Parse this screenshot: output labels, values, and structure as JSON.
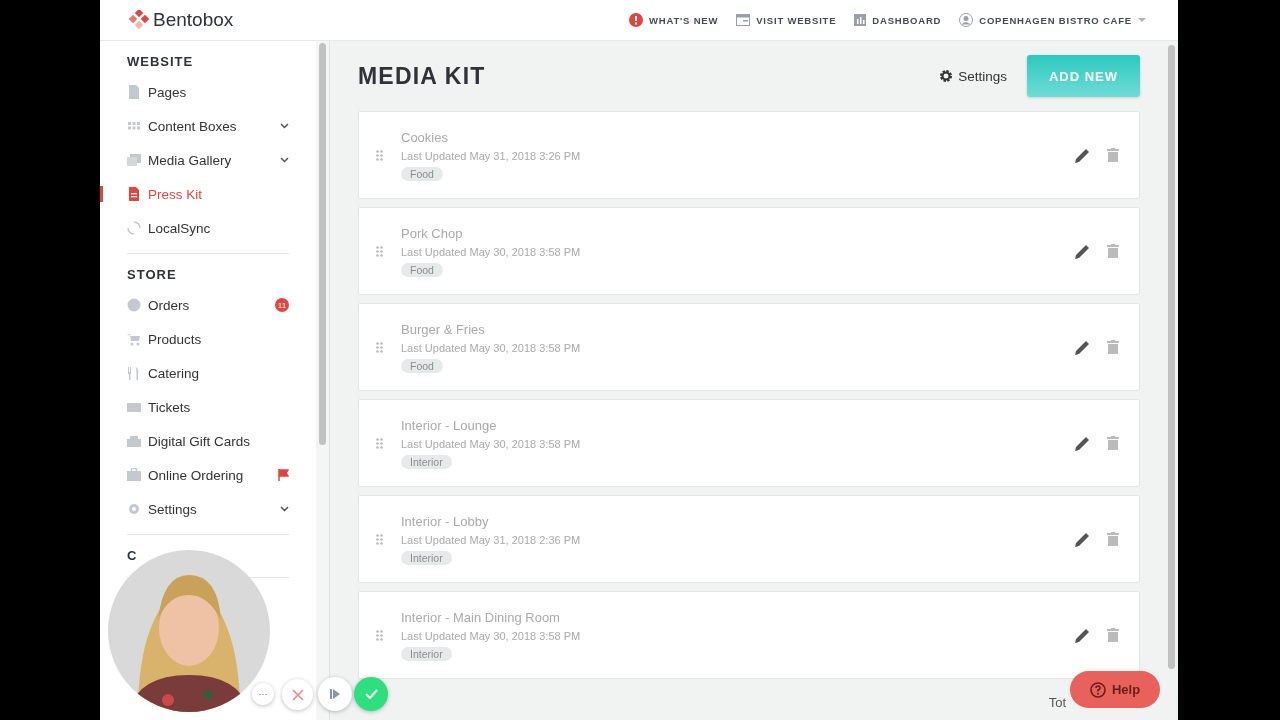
{
  "header": {
    "logo": "Bentobox",
    "links": [
      {
        "label": "WHAT'S NEW"
      },
      {
        "label": "VISIT WEBSITE"
      },
      {
        "label": "DASHBOARD"
      },
      {
        "label": "COPENHAGEN BISTRO CAFE"
      }
    ]
  },
  "sidebar": {
    "sections": [
      {
        "title": "WEBSITE",
        "items": [
          {
            "label": "Pages",
            "selected": false
          },
          {
            "label": "Content Boxes",
            "selected": false,
            "chevron": true
          },
          {
            "label": "Media Gallery",
            "selected": false,
            "chevron": true
          },
          {
            "label": "Press Kit",
            "selected": true
          },
          {
            "label": "LocalSync",
            "selected": false
          }
        ]
      },
      {
        "title": "STORE",
        "items": [
          {
            "label": "Orders",
            "selected": false,
            "badge": "11"
          },
          {
            "label": "Products",
            "selected": false
          },
          {
            "label": "Catering",
            "selected": false
          },
          {
            "label": "Tickets",
            "selected": false
          },
          {
            "label": "Digital Gift Cards",
            "selected": false
          },
          {
            "label": "Online Ordering",
            "selected": false,
            "flag": true
          },
          {
            "label": "Settings",
            "selected": false,
            "chevron": true
          }
        ]
      },
      {
        "title": "C"
      }
    ]
  },
  "main": {
    "title": "MEDIA KIT",
    "settings": "Settings",
    "add_button": "ADD NEW",
    "cards": [
      {
        "title": "Cookies",
        "updated": "Last Updated May 31, 2018 3:26 PM",
        "tag": "Food"
      },
      {
        "title": "Pork Chop",
        "updated": "Last Updated May 30, 2018 3:58 PM",
        "tag": "Food"
      },
      {
        "title": "Burger & Fries",
        "updated": "Last Updated May 30, 2018 3:58 PM",
        "tag": "Food"
      },
      {
        "title": "Interior - Lounge",
        "updated": "Last Updated May 30, 2018 3:58 PM",
        "tag": "Interior"
      },
      {
        "title": "Interior - Lobby",
        "updated": "Last Updated May 31, 2018 2:36 PM",
        "tag": "Interior"
      },
      {
        "title": "Interior - Main Dining Room",
        "updated": "Last Updated May 30, 2018 3:58 PM",
        "tag": "Interior"
      }
    ],
    "footer": "Tot"
  },
  "help_button": "Help",
  "video_overlay": {
    "kind": "picture",
    "controls": [
      "···"
    ]
  }
}
